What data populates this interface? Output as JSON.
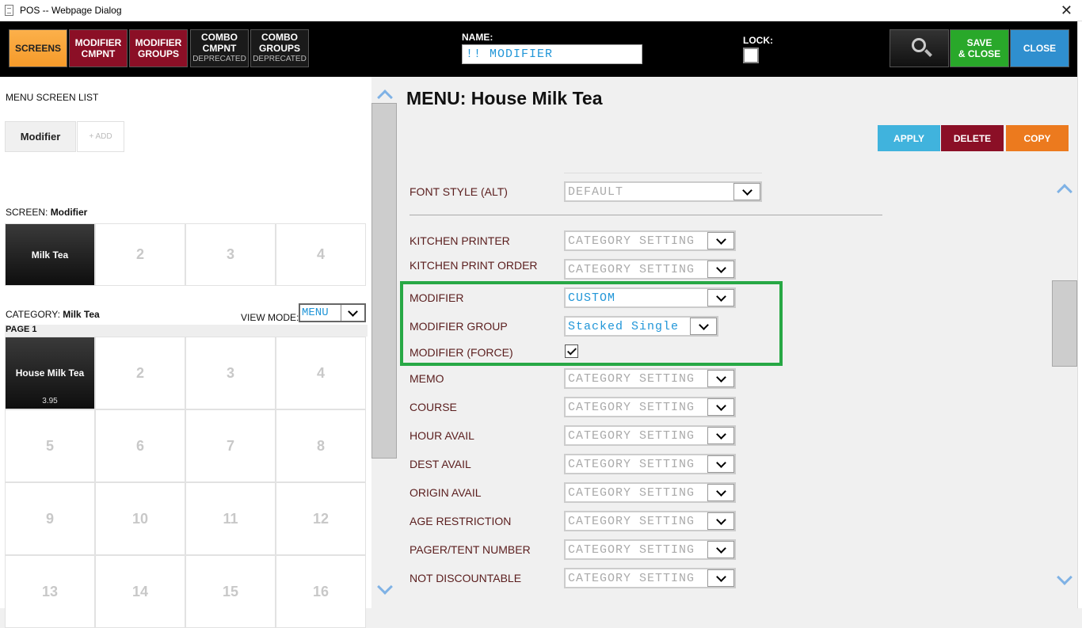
{
  "window": {
    "title": "POS -- Webpage Dialog",
    "close_glyph": "✕"
  },
  "toolbar": {
    "screens": "SCREENS",
    "modifier_cmpnt": [
      "MODIFIER",
      "CMPNT"
    ],
    "modifier_groups": [
      "MODIFIER",
      "GROUPS"
    ],
    "combo_cmpnt": [
      "COMBO",
      "CMPNT",
      "DEPRECATED"
    ],
    "combo_groups": [
      "COMBO",
      "GROUPS",
      "DEPRECATED"
    ],
    "name_label": "NAME:",
    "name_value": "!! MODIFIER",
    "lock_label": "LOCK:",
    "save": [
      "SAVE",
      "& CLOSE"
    ],
    "close": "CLOSE"
  },
  "left": {
    "menu_screen_list": "MENU SCREEN LIST",
    "tabs": [
      "Modifier",
      "+ ADD"
    ],
    "screen_label": "SCREEN: ",
    "screen_name": "Modifier",
    "screens": [
      "Milk Tea",
      "2",
      "3",
      "4"
    ],
    "category_label": "CATEGORY: ",
    "category_name": "Milk Tea",
    "view_mode_label": "VIEW MODE:",
    "view_mode_value": "MENU",
    "page_label": "PAGE 1",
    "items": [
      {
        "label": "House Milk Tea",
        "price": "3.95"
      },
      {
        "label": "2"
      },
      {
        "label": "3"
      },
      {
        "label": "4"
      },
      {
        "label": "5"
      },
      {
        "label": "6"
      },
      {
        "label": "7"
      },
      {
        "label": "8"
      },
      {
        "label": "9"
      },
      {
        "label": "10"
      },
      {
        "label": "11"
      },
      {
        "label": "12"
      },
      {
        "label": "13"
      },
      {
        "label": "14"
      },
      {
        "label": "15"
      },
      {
        "label": "16"
      }
    ]
  },
  "right": {
    "title": "MENU: House Milk Tea",
    "actions": {
      "apply": "APPLY",
      "delete": "DELETE",
      "copy": "COPY"
    },
    "fields": {
      "font_style_alt": {
        "label": "FONT STYLE (ALT)",
        "value": "DEFAULT"
      },
      "kitchen_printer": {
        "label": "KITCHEN PRINTER",
        "value": "CATEGORY SETTING"
      },
      "kitchen_print_order": {
        "label": "KITCHEN PRINT ORDER",
        "value": "CATEGORY SETTING"
      },
      "modifier": {
        "label": "MODIFIER",
        "value": "CUSTOM"
      },
      "modifier_group": {
        "label": "MODIFIER GROUP",
        "value": "Stacked Single"
      },
      "modifier_force": {
        "label": "MODIFIER (FORCE)",
        "checked": true
      },
      "memo": {
        "label": "MEMO",
        "value": "CATEGORY SETTING"
      },
      "course": {
        "label": "COURSE",
        "value": "CATEGORY SETTING"
      },
      "hour_avail": {
        "label": "HOUR AVAIL",
        "value": "CATEGORY SETTING"
      },
      "dest_avail": {
        "label": "DEST AVAIL",
        "value": "CATEGORY SETTING"
      },
      "origin_avail": {
        "label": "ORIGIN AVAIL",
        "value": "CATEGORY SETTING"
      },
      "age_restriction": {
        "label": "AGE RESTRICTION",
        "value": "CATEGORY SETTING"
      },
      "pager_tent_number": {
        "label": "PAGER/TENT NUMBER",
        "value": "CATEGORY SETTING"
      },
      "not_discountable": {
        "label": "NOT DISCOUNTABLE",
        "value": "CATEGORY SETTING"
      }
    }
  },
  "colors": {
    "accent_orange": "#f59a2a",
    "maroon": "#8b0f26",
    "green": "#29a82a",
    "blue": "#2f8fcf",
    "highlight_green": "#27a845",
    "value_blue": "#2196d8"
  }
}
